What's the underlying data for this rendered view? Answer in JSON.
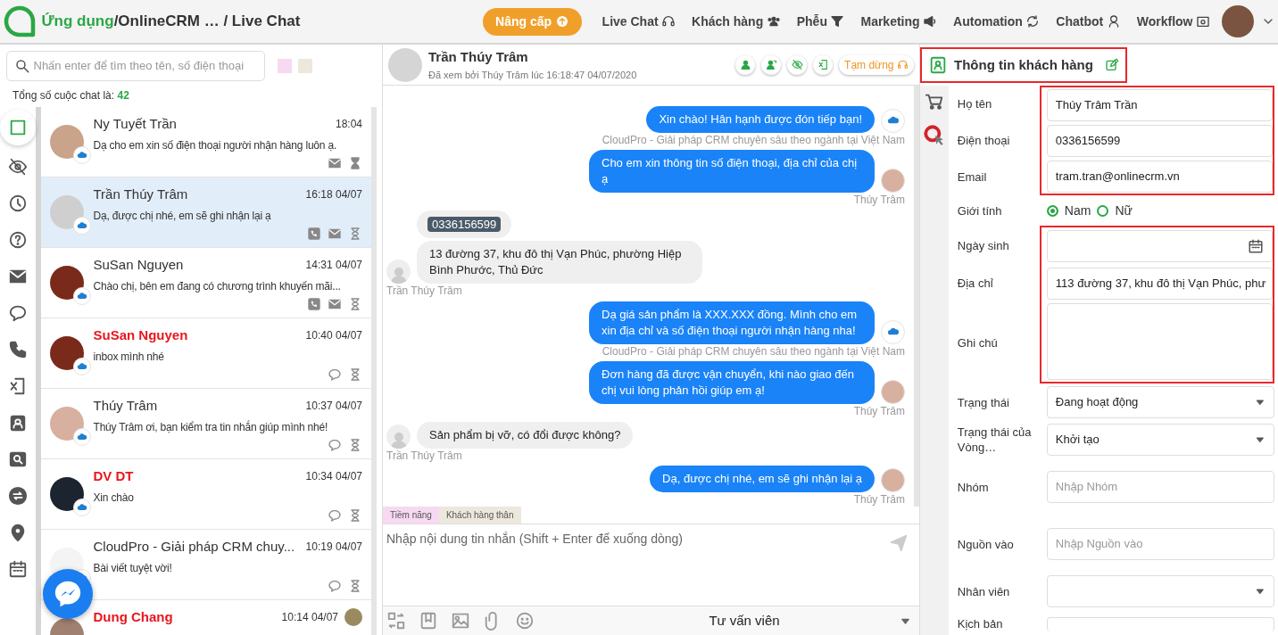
{
  "app_bar": {
    "breadcrumb": [
      {
        "kind": "app",
        "text": "Ứng dụng"
      },
      {
        "kind": "path",
        "text": "/OnlineCRM … / Live Chat"
      }
    ],
    "upgrade_button": "Nâng cấp",
    "nav_items": [
      {
        "label": "Live Chat"
      },
      {
        "label": "Khách hàng"
      },
      {
        "label": "Phễu"
      },
      {
        "label": "Marketing"
      },
      {
        "label": "Automation"
      },
      {
        "label": "Chatbot"
      },
      {
        "label": "Workflow"
      }
    ]
  },
  "chat_list": {
    "search": {
      "placeholder": "Nhấn enter để tìm theo tên, số điện thoại"
    },
    "tag_filters": [
      {
        "color": "#f7d9f1"
      },
      {
        "color": "#ede8dc"
      }
    ],
    "count_label": "Tổng số cuộc chat là:",
    "count": "42",
    "rail": [
      {
        "selected": true
      },
      {
        "selected": false
      },
      {
        "selected": false
      },
      {
        "selected": false
      },
      {
        "selected": false
      },
      {
        "selected": false
      },
      {
        "selected": false
      },
      {
        "selected": false
      },
      {
        "selected": false
      },
      {
        "selected": false
      },
      {
        "selected": false
      },
      {
        "selected": false
      },
      {
        "selected": false
      }
    ],
    "conversations": [
      {
        "name": "Ny Tuyết Trần",
        "time": "18:04",
        "preview": "Dạ cho em xin số điện thoại người nhận hàng luôn ạ.",
        "kind": "email",
        "unread": false,
        "selected": false
      },
      {
        "name": "Trần Thúy Trâm",
        "time": "16:18 04/07",
        "preview": "Dạ, được chị nhé, em sẽ ghi nhận lại ạ",
        "kind": "phone",
        "unread": false,
        "selected": true
      },
      {
        "name": "SuSan Nguyen",
        "time": "14:31 04/07",
        "preview": "Chào chị, bên em đang có chương trình khuyến mãi...",
        "kind": "phone",
        "unread": false,
        "selected": false
      },
      {
        "name": "SuSan Nguyen",
        "time": "10:40 04/07",
        "preview": "inbox mình nhé",
        "kind": "chat",
        "unread": true,
        "selected": false
      },
      {
        "name": "Thúy Trâm",
        "time": "10:37 04/07",
        "preview": "Thúy Trâm ơi, bạn kiểm tra tin nhắn giúp mình nhé!",
        "kind": "chat",
        "unread": false,
        "selected": false
      },
      {
        "name": "DV DT",
        "time": "10:34 04/07",
        "preview": "Xin chào",
        "kind": "chat",
        "unread": true,
        "selected": false
      },
      {
        "name": "CloudPro - Giải pháp CRM chuy...",
        "time": "10:19 04/07",
        "preview": "Bài viết tuyệt vời!",
        "kind": "chat",
        "unread": false,
        "selected": false
      },
      {
        "name": "Dung Chang",
        "time": "10:14 04/07",
        "kind": "agent",
        "unread": true,
        "selected": false
      }
    ]
  },
  "chat": {
    "name": "Trần Thúy Trâm",
    "seen": "Đã xem bởi Thúy Trâm lúc 16:18:47 04/07/2020",
    "pause_button": "Tạm dừng",
    "messages": [
      {
        "kind": "out-brand",
        "text": "Xin chào! Hân hạnh được đón tiếp bạn!",
        "sender": "CloudPro - Giải pháp CRM chuyên sâu theo ngành tại Việt Nam"
      },
      {
        "kind": "out-person",
        "text": "Cho em xin thông tin số điện thoại, địa chỉ của chị ạ",
        "sender": "Thúy Trâm"
      },
      {
        "kind": "in",
        "chip": "0336156599",
        "text": "13 đường 37, khu đô thị Vạn Phúc, phường Hiệp Bình Phước, Thủ Đức",
        "sender": "Trần Thúy Trâm"
      },
      {
        "kind": "out-brand",
        "text": "Dạ giá sản phẩm là XXX.XXX đồng. Mình cho em xin địa chỉ và số điện thoại người nhận hàng nha!",
        "sender": "CloudPro - Giải pháp CRM chuyên sâu theo ngành tại Việt Nam"
      },
      {
        "kind": "out-person",
        "text": "Đơn hàng đã được vận chuyển, khi nào giao đến chị vui lòng phản hồi giúp em ạ!",
        "sender": "Thúy Trâm"
      },
      {
        "kind": "in",
        "text": "Sản phẩm bị vỡ, có đổi được không?",
        "sender": "Trần Thúy Trâm"
      },
      {
        "kind": "out-person",
        "text": "Dạ, được chị nhé, em sẽ ghi nhận lại ạ",
        "sender": "Thúy Trâm"
      }
    ],
    "tags": [
      {
        "text": "Tiềm năng",
        "color": "#f7d9f1"
      },
      {
        "text": "Khách hàng thân",
        "color": "#ede8dc"
      }
    ],
    "composer": {
      "placeholder": "Nhập nội dung tin nhắn (Shift + Enter để xuống dòng)"
    },
    "agent_select": "Tư vấn viên"
  },
  "customer": {
    "title": "Thông tin khách hàng",
    "highlighted": true,
    "fields": [
      {
        "kind": "text",
        "label": "Họ tên",
        "value": "Thúy Trâm Trần",
        "highlighted": true
      },
      {
        "kind": "text",
        "label": "Điện thoại",
        "value": "0336156599",
        "highlighted": true
      },
      {
        "kind": "text",
        "label": "Email",
        "value": "tram.tran@onlinecrm.vn",
        "highlighted": true
      },
      {
        "kind": "radio",
        "label": "Giới tính",
        "options": [
          {
            "label": "Nam",
            "selected": true
          },
          {
            "label": "Nữ",
            "selected": false
          }
        ],
        "highlighted": false
      },
      {
        "kind": "date",
        "label": "Ngày sinh",
        "highlighted": true
      },
      {
        "kind": "text",
        "label": "Địa chỉ",
        "value": "113 đường 37, khu đô thị Vạn Phúc, phư",
        "highlighted": true
      },
      {
        "kind": "textarea",
        "label": "Ghi chú",
        "highlighted": true
      },
      {
        "kind": "select",
        "label": "Trạng thái",
        "value": "Đang hoạt động",
        "highlighted": false
      },
      {
        "kind": "select",
        "label": "Trạng thái của Vòng…",
        "value": "Khởi tạo",
        "highlighted": false
      },
      {
        "kind": "tags",
        "label": "Nhóm",
        "placeholder": "Nhập Nhóm",
        "highlighted": false
      },
      {
        "kind": "tags",
        "label": "Nguồn vào",
        "placeholder": "Nhập Nguồn vào",
        "highlighted": false
      },
      {
        "kind": "select",
        "label": "Nhân viên",
        "highlighted": false
      },
      {
        "kind": "partial",
        "label": "Kịch bản",
        "highlighted": false
      }
    ]
  }
}
